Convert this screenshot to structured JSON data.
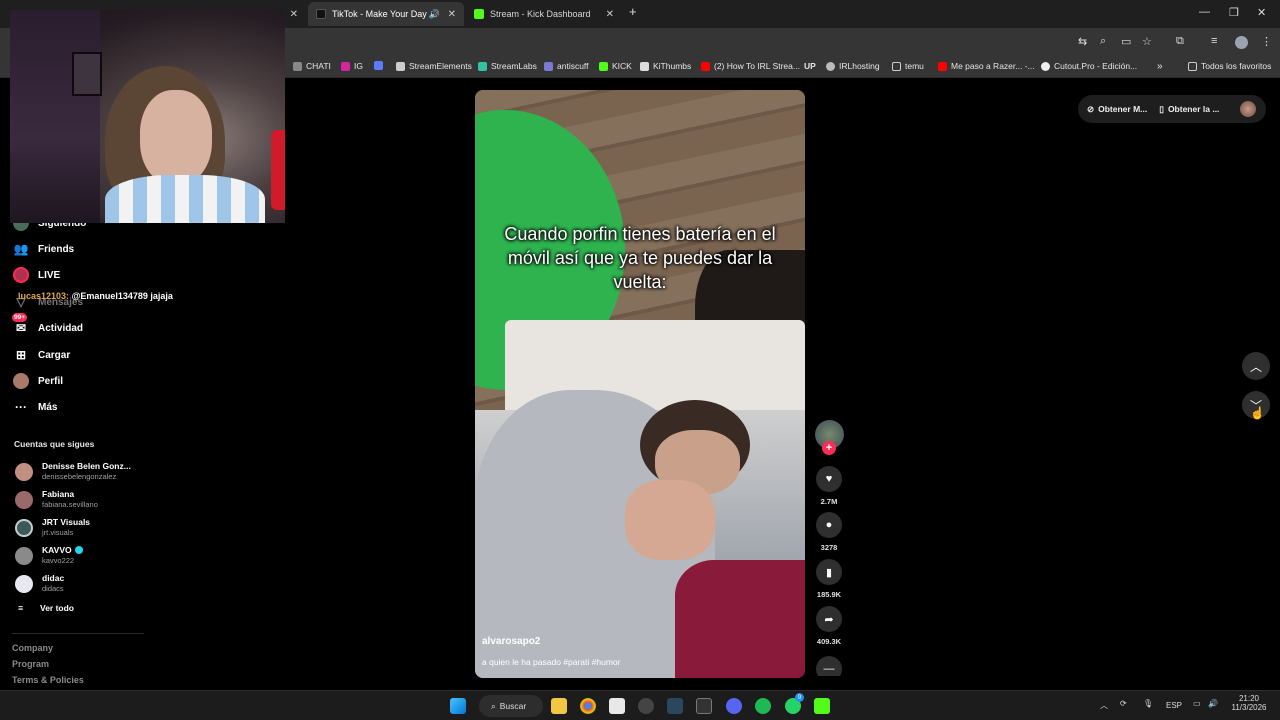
{
  "browser": {
    "tabs": [
      {
        "label": "TikTok - Make Your Day",
        "active": true
      },
      {
        "label": "Stream - Kick Dashboard",
        "active": false
      }
    ],
    "new_tab": "+",
    "bookmarks": [
      "CHATI",
      "IG",
      "StreamElements",
      "StreamLabs",
      "antiscuff",
      "KICK",
      "KiThumbs",
      "(2) How To IRL Strea...",
      "UP",
      "IRLhosting",
      "temu",
      "Me paso a Razer... -...",
      "Cutout.Pro - Edición...",
      "Todos los favoritos"
    ]
  },
  "sidebar": {
    "nav": [
      {
        "label": "Siguiendo",
        "icon": "following-icon"
      },
      {
        "label": "Friends",
        "icon": "friends-icon"
      },
      {
        "label": "LIVE",
        "icon": "live-icon"
      },
      {
        "label": "Mensajes",
        "icon": "messages-icon"
      },
      {
        "label": "Actividad",
        "icon": "activity-icon",
        "badge": "99+"
      },
      {
        "label": "Cargar",
        "icon": "upload-icon"
      },
      {
        "label": "Perfil",
        "icon": "profile-icon"
      },
      {
        "label": "Más",
        "icon": "more-icon"
      }
    ],
    "following_title": "Cuentas que sigues",
    "accounts": [
      {
        "name": "Denisse Belen Gonz...",
        "handle": "denissebelengonzalez",
        "verified": false
      },
      {
        "name": "Fabiana",
        "handle": "fabiana.sevillano",
        "verified": false
      },
      {
        "name": "JRT Visuals",
        "handle": "jrt.visuals",
        "verified": false
      },
      {
        "name": "KAVVO",
        "handle": "kavvo222",
        "verified": true
      },
      {
        "name": "didac",
        "handle": "didacs",
        "verified": false
      }
    ],
    "see_all": "Ver todo",
    "footer": [
      "Company",
      "Program",
      "Terms & Policies"
    ]
  },
  "chat_overlay": {
    "user": "lucas12103:",
    "message": "@Emanuel134789 jajaja"
  },
  "video": {
    "caption": "Cuando porfin tienes batería en el móvil así que ya te puedes dar la vuelta:",
    "author": "alvarosapo2",
    "description": "a quien le ha pasado #parati #humor"
  },
  "actions": {
    "likes": "2.7M",
    "comments": "3278",
    "saves": "185.9K",
    "shares": "409.3K"
  },
  "top_right": {
    "get_app": "Obtener M...",
    "get_app2": "Obtener la ..."
  },
  "taskbar": {
    "search": "Buscar",
    "language": "ESP",
    "time": "21:20",
    "date": "11/3/2026",
    "whatsapp_badge": "9"
  }
}
